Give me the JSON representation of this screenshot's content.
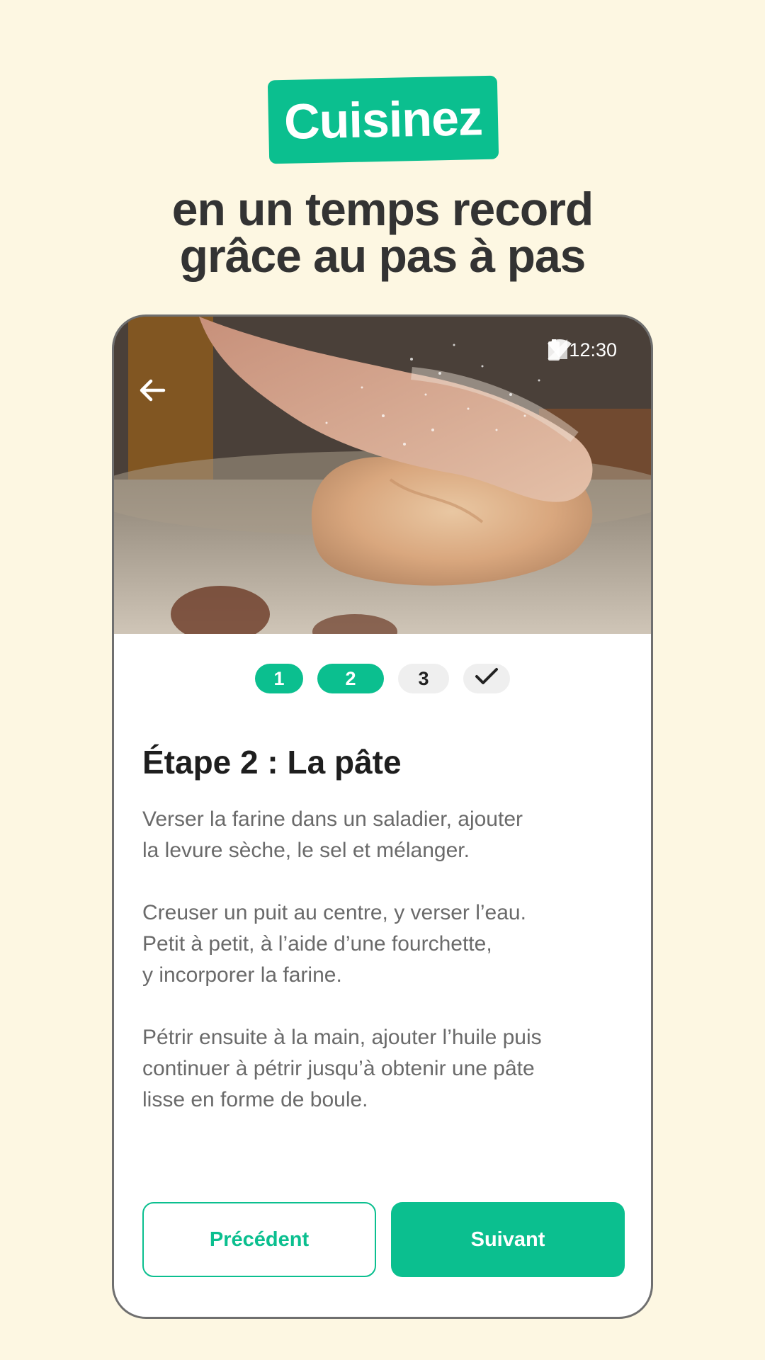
{
  "hero_badge": "Cuisinez",
  "headline": {
    "line1": "en un temps record",
    "line2": "grâce au pas à pas"
  },
  "colors": {
    "background": "#fdf7e2",
    "accent": "#0bbf8f",
    "heading": "#333333",
    "body_text": "#6a6a6a"
  },
  "status_bar": {
    "time": "12:30",
    "icons": [
      "wifi-icon",
      "cell-signal-icon",
      "battery-icon"
    ]
  },
  "recipe_photo": {
    "icon": "back-arrow-icon"
  },
  "step_indicator": {
    "steps": [
      {
        "label": "1",
        "state": "done"
      },
      {
        "label": "2",
        "state": "current"
      },
      {
        "label": "3",
        "state": "todo"
      },
      {
        "label": "",
        "icon": "check-icon",
        "state": "todo"
      }
    ]
  },
  "step": {
    "title": "Étape 2 : La pâte",
    "paragraphs": [
      [
        "Verser la farine dans un saladier, ajouter",
        "la levure sèche, le sel et mélanger."
      ],
      [
        "Creuser un puit au centre, y verser l’eau.",
        "Petit à petit, à l’aide d’une fourchette,",
        "y incorporer la farine."
      ],
      [
        "Pétrir ensuite à la main, ajouter l’huile puis",
        "continuer à pétrir jusqu’à obtenir une pâte",
        "lisse en forme de boule."
      ]
    ]
  },
  "buttons": {
    "previous": "Précédent",
    "next": "Suivant"
  }
}
